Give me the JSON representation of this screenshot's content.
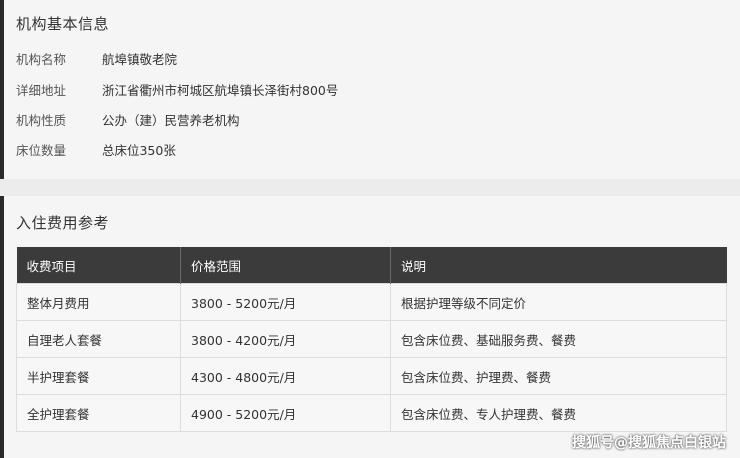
{
  "basic_info": {
    "title": "机构基本信息",
    "rows": [
      {
        "label": "机构名称",
        "value": "航埠镇敬老院"
      },
      {
        "label": "详细地址",
        "value": "浙江省衢州市柯城区航埠镇长泽街村800号"
      },
      {
        "label": "机构性质",
        "value": "公办（建）民营养老机构"
      },
      {
        "label": "床位数量",
        "value": "总床位350张"
      }
    ]
  },
  "fees": {
    "title": "入住费用参考",
    "headers": [
      "收费项目",
      "价格范围",
      "说明"
    ],
    "rows": [
      [
        "整体月费用",
        "3800 - 5200元/月",
        "根据护理等级不同定价"
      ],
      [
        "自理老人套餐",
        "3800 - 4200元/月",
        "包含床位费、基础服务费、餐费"
      ],
      [
        "半护理套餐",
        "4300 - 4800元/月",
        "包含床位费、护理费、餐费"
      ],
      [
        "全护理套餐",
        "4900 - 5200元/月",
        "包含床位费、专人护理费、餐费"
      ]
    ]
  },
  "watermark": "搜狐号@搜狐焦点白银站"
}
